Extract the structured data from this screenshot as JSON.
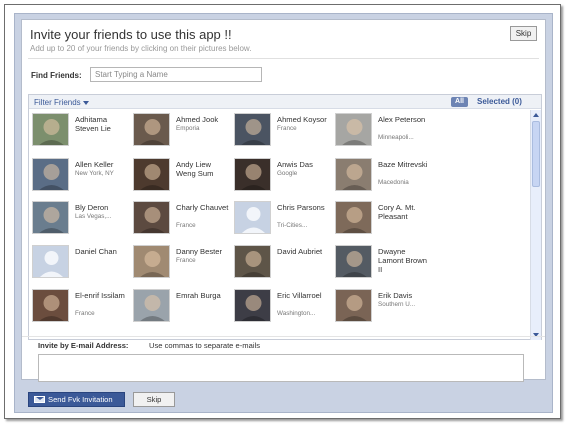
{
  "header": {
    "title": "Invite your friends to use this app !!",
    "subtitle": "Add up to 20 of your friends by clicking on their pictures below.",
    "skip_label": "Skip"
  },
  "find": {
    "label": "Find Friends:",
    "placeholder": "Start Typing a Name"
  },
  "filter": {
    "label": "Filter Friends",
    "all_label": "All",
    "selected_label": "Selected (0)"
  },
  "friends": [
    {
      "name": "Adhitama Steven Lie",
      "location": "",
      "photo": "#7c8f6d"
    },
    {
      "name": "Ahmed Jook",
      "location": "Emporia",
      "photo": "#6a5a4d"
    },
    {
      "name": "Ahmed Koysor",
      "location": "France",
      "photo": "#4b5462"
    },
    {
      "name": "Alex Peterson",
      "location": "Minneapoli...",
      "photo": "#a6a6a3"
    },
    {
      "name": "Allen Keller",
      "location": "New York, NY",
      "photo": "#5a6d86"
    },
    {
      "name": "Andy Liew Weng Sum",
      "location": "",
      "photo": "#4d3a2e"
    },
    {
      "name": "Anwis Das",
      "location": "Google",
      "photo": "#3a2f2a"
    },
    {
      "name": "Baze Mitrevski",
      "location": "Macedonia",
      "photo": "#8a7d70"
    },
    {
      "name": "Bly Deron",
      "location": "Las Vegas,...",
      "photo": "#6a7d8e"
    },
    {
      "name": "Charly Chauvet",
      "location": "France",
      "photo": "#5c4a40"
    },
    {
      "name": "Chris Parsons",
      "location": "Tri-Cities...",
      "photo": "#c7d2e3"
    },
    {
      "name": "Cory A. Mt. Pleasant",
      "location": "",
      "photo": "#7e6a5a"
    },
    {
      "name": "Daniel Chan",
      "location": "",
      "photo": "#c7d2e3"
    },
    {
      "name": "Danny Bester",
      "location": "France",
      "photo": "#a08a72"
    },
    {
      "name": "David Aubriet",
      "location": "",
      "photo": "#5e5548"
    },
    {
      "name": "Dwayne Lamont Brown II",
      "location": "",
      "photo": "#545b63"
    },
    {
      "name": "El-enrif Issilam",
      "location": "France",
      "photo": "#6b4d3e"
    },
    {
      "name": "Emrah Burga",
      "location": "",
      "photo": "#9aa3ab"
    },
    {
      "name": "Eric Villarroel",
      "location": "Washington...",
      "photo": "#3d3d46"
    },
    {
      "name": "Erik Davis",
      "location": "Southern U...",
      "photo": "#7a6455"
    }
  ],
  "invite": {
    "label": "Invite by E-mail Address:",
    "hint": "Use commas to separate e-mails"
  },
  "footer": {
    "send_label": "Send Fvk Invitation",
    "skip_label": "Skip"
  }
}
